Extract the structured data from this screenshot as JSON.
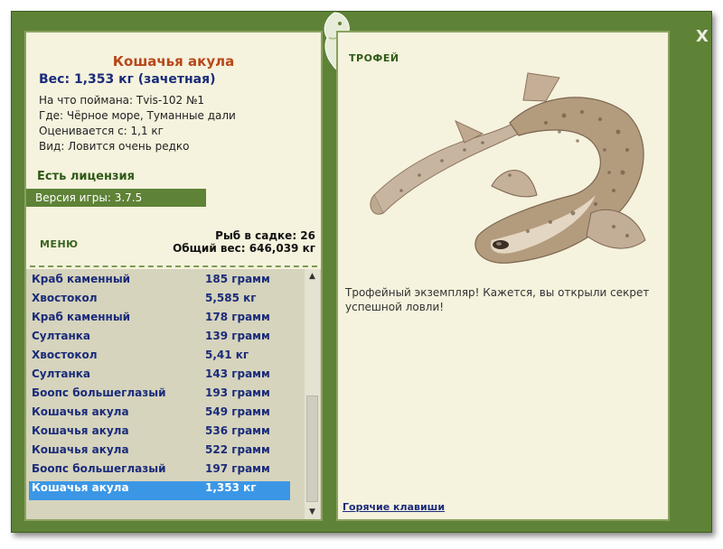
{
  "window": {
    "close_label": "X"
  },
  "fish": {
    "name": "Кошачья акула",
    "weight": "Вес: 1,353 кг (зачетная)",
    "info": [
      "На что поймана: Tvis-102 №1",
      "Где: Чёрное море, Туманные дали",
      "Оценивается с: 1,1 кг",
      "Вид: Ловится очень редко"
    ]
  },
  "license": "Есть лицензия",
  "version": "Версия игры: 3.7.5",
  "menu_title": "МЕНЮ",
  "stats": {
    "count": "Рыб в садке: 26",
    "total": "Общий вес: 646,039 кг"
  },
  "catch_list": [
    {
      "name": "Краб каменный",
      "weight": "185 грамм"
    },
    {
      "name": "Хвостокол",
      "weight": "5,585 кг"
    },
    {
      "name": "Краб каменный",
      "weight": "178 грамм"
    },
    {
      "name": "Султанка",
      "weight": "139 грамм"
    },
    {
      "name": "Хвостокол",
      "weight": "5,41 кг"
    },
    {
      "name": "Султанка",
      "weight": "143 грамм"
    },
    {
      "name": "Боопс большеглазый",
      "weight": "193 грамм"
    },
    {
      "name": "Кошачья акула",
      "weight": "549 грамм"
    },
    {
      "name": "Кошачья акула",
      "weight": "536 грамм"
    },
    {
      "name": "Кошачья акула",
      "weight": "522 грамм"
    },
    {
      "name": "Боопс большеглазый",
      "weight": "197 грамм"
    },
    {
      "name": "Кошачья акула",
      "weight": "1,353 кг",
      "selected": true
    }
  ],
  "trophy": {
    "title": "ТРОФЕЙ",
    "description": "Трофейный экземпляр! Кажется, вы открыли секрет успешной ловли!"
  },
  "hotkeys_label": "Горячие клавиши",
  "colors": {
    "frame": "#5e8236",
    "panel": "#f5f2dd",
    "selected_row": "#3b97e6",
    "list_text": "#1a2b7a",
    "fish_name": "#b8471a"
  },
  "icons": {
    "close": "close-icon",
    "logo": "fish-logo-icon",
    "scroll_up": "arrow-up-icon",
    "scroll_down": "arrow-down-icon"
  }
}
